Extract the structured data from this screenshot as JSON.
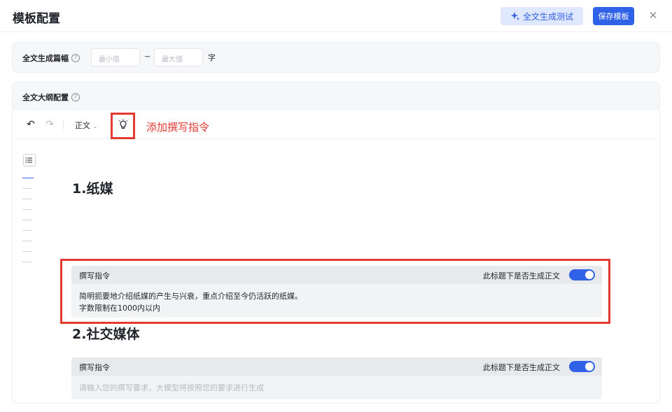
{
  "header": {
    "title": "模板配置",
    "test_button": "全文生成测试",
    "save_button": "保存模板"
  },
  "length": {
    "label": "全文生成篇幅",
    "min_placeholder": "最小值",
    "max_placeholder": "最大值",
    "separator": "~",
    "unit": "字"
  },
  "outline": {
    "label": "全文大纲配置",
    "toolbar": {
      "style_label": "正文",
      "annotation": "添加撰写指令"
    },
    "sections": [
      {
        "heading": "1.纸媒",
        "instruction_title": "撰写指令",
        "toggle_question": "此标题下是否生成正文",
        "toggle_on": true,
        "instruction_lines": [
          "简明扼要地介绍纸媒的产生与兴衰，重点介绍至今仍活跃的纸媒。",
          "字数限制在1000内以内"
        ]
      },
      {
        "heading": "2.社交媒体",
        "instruction_title": "撰写指令",
        "toggle_question": "此标题下是否生成正文",
        "toggle_on": true,
        "placeholder": "请输入您的撰写要求，大模型将按照您的要求进行生成"
      }
    ]
  },
  "colors": {
    "accent": "#2f62e6",
    "annotation_red": "#e33a32"
  }
}
